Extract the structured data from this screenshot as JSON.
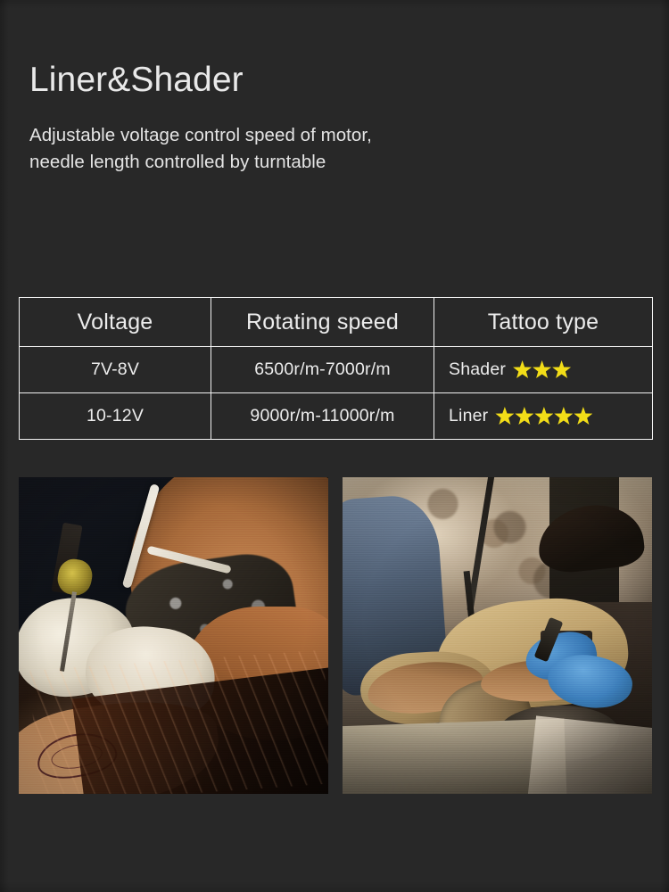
{
  "header": {
    "title": "Liner&Shader",
    "subtitle": "Adjustable voltage control  speed of motor,\nneedle length controlled by turntable"
  },
  "spec_table": {
    "columns": [
      "Voltage",
      "Rotating speed",
      "Tattoo type"
    ],
    "rows": [
      {
        "voltage": "7V-8V",
        "rotating_speed": "6500r/m-7000r/m",
        "tattoo_type_label": "Shader",
        "tattoo_type_stars": 3
      },
      {
        "voltage": "10-12V",
        "rotating_speed": "9000r/m-11000r/m",
        "tattoo_type_label": "Liner",
        "tattoo_type_stars": 5
      }
    ]
  },
  "photos": [
    {
      "name": "tattoo-artist-masked-forearm-photo"
    },
    {
      "name": "tattoo-studio-artist-client-photo"
    }
  ],
  "colors": {
    "background": "#282828",
    "text": "#e9e9e9",
    "table_border": "#f2f2f2",
    "star": "#f2dd18"
  }
}
